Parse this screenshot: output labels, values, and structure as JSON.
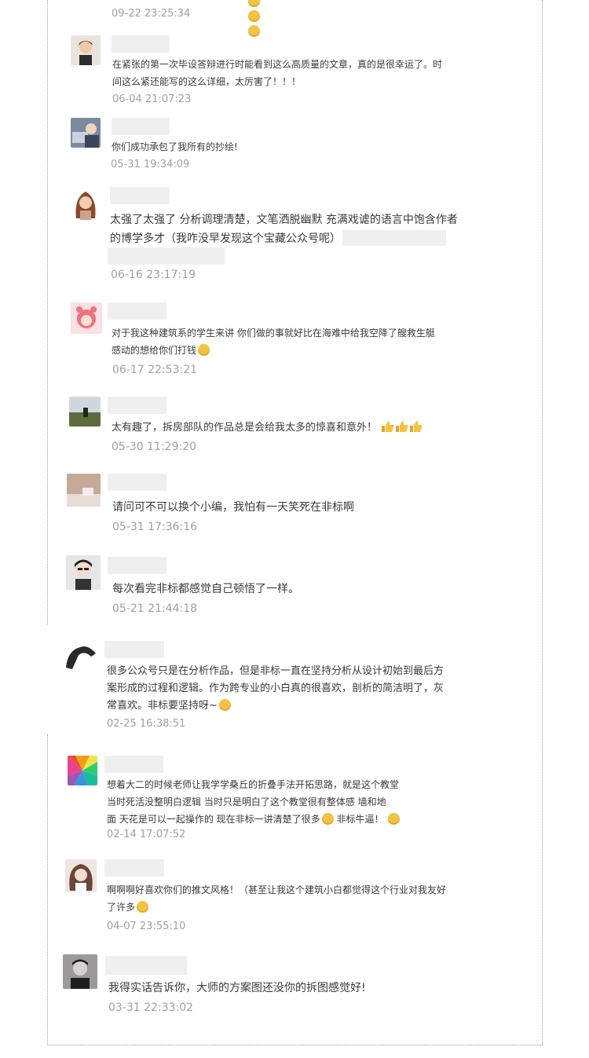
{
  "comments": [
    {
      "time": "09-22 23:25:34"
    },
    {
      "text": "在紧张的第一次毕设答辩进行时能看到这么高质量的文章，真的是很幸运了。时间这么紧还能写的这么详细，太厉害了！！！",
      "time": "06-04 21:07:23"
    },
    {
      "text": "你们成功承包了我所有的抄绘!",
      "time": "05-31 19:34:09"
    },
    {
      "text": "太强了太强了 分析调理清楚，文笔洒脱幽默 充满戏谑的语言中饱含作者的博学多才（我咋没早发现这个宝藏公众号呢）",
      "time": "06-16 23:17:19"
    },
    {
      "text": "对于我这种建筑系的学生来讲 你们做的事就好比在海难中给我空降了艘救生艇 感动的想给你们打钱",
      "time": "06-17 22:53:21"
    },
    {
      "text": "太有趣了，拆房部队的作品总是会给我太多的惊喜和意外！",
      "time": "05-30 11:29:20"
    },
    {
      "text": "请问可不可以换个小编，我怕有一天笑死在非标啊",
      "time": "05-31 17:36:16"
    },
    {
      "text": "每次看完非标都感觉自己顿悟了一样。",
      "time": "05-21 21:44:18"
    },
    {
      "text": "很多公众号只是在分析作品，但是非标一直在坚持分析从设计初始到最后方案形成的过程和逻辑。作为跨专业的小白真的很喜欢，剖析的简洁明了，灰常喜欢。非标要坚持呀~",
      "time": "02-25 16:38:51"
    },
    {
      "line1": "想着大二的时候老师让我学学桑丘的折叠手法开拓思路，就是这个教堂",
      "line2": "当时死活没整明白逻辑 当时只是明白了这个教堂很有整体感 墙和地",
      "line3a": "面 天花是可以一起操作的 现在非标一讲清楚了很多",
      "line3b": " 非标牛逼！",
      "time": "02-14 17:07:52"
    },
    {
      "text": "啊啊啊好喜欢你们的推文风格！（甚至让我这个建筑小白都觉得这个行业对我友好了许多",
      "time": "04-07 23:55:10"
    },
    {
      "text": "我得实话告诉你，大师的方案图还没你的拆图感觉好!",
      "time": "03-31 22:33:02"
    }
  ],
  "colors": {
    "background": "#ffffff",
    "text": "#3a3a3a",
    "timestamp": "#a0a0a0",
    "name_placeholder": "#efefef",
    "frame": "#9a9a9a"
  },
  "icons": [
    "emoji-laugh-icon",
    "emoji-cry-icon",
    "thumbs-up-icon",
    "emoji-grin-icon",
    "emoji-smirk-icon",
    "emoji-cat-icon"
  ]
}
